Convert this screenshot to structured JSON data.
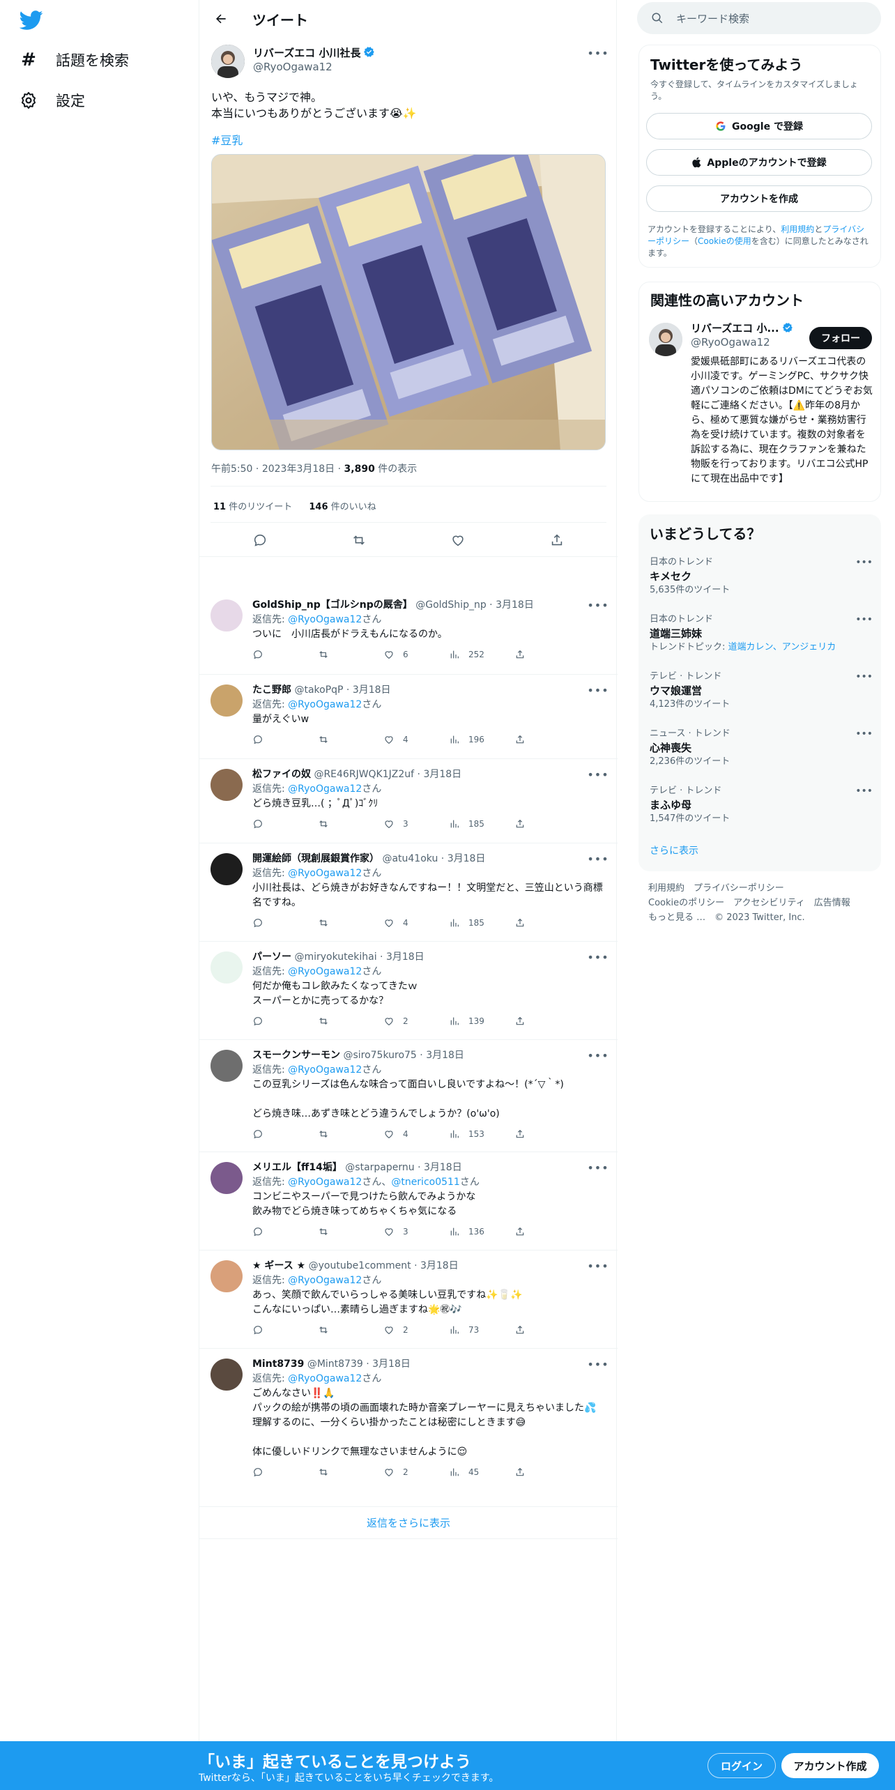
{
  "nav": {
    "explore_label": "話題を検索",
    "settings_label": "設定"
  },
  "header": {
    "title": "ツイート"
  },
  "tweet": {
    "author_name": "リバーズエコ 小川社長",
    "author_handle": "@RyoOgawa12",
    "text": "いや、もうマジで神。\n本当にいつもありがとうございます😭✨",
    "hashtag": "#豆乳",
    "time": "午前5:50",
    "date": "2023年3月18日",
    "views_count": "3,890",
    "views_label": "件の表示",
    "retweets_count": "11",
    "retweets_label": "件のリツイート",
    "likes_count": "146",
    "likes_label": "件のいいね"
  },
  "reply_prefix": "返信先: ",
  "reply_suffix": "さん",
  "replies": [
    {
      "name": "GoldShip_np【ゴルシnpの厩舎】",
      "handle": "@GoldShip_np",
      "date": "3月18日",
      "to": "@RyoOgawa12",
      "to2": "",
      "text": "ついに　小川店長がドラえもんになるのか。",
      "likes": "6",
      "views": "252"
    },
    {
      "name": "たこ野郎",
      "handle": "@takoPqP",
      "date": "3月18日",
      "to": "@RyoOgawa12",
      "to2": "",
      "text": "量がえぐいw",
      "likes": "4",
      "views": "196"
    },
    {
      "name": "松ファイの奴",
      "handle": "@RE46RJWQK1JZ2uf",
      "date": "3月18日",
      "to": "@RyoOgawa12",
      "to2": "",
      "text": "どら焼き豆乳…( ；ﾟДﾟ)ｺﾞｸﾘ",
      "likes": "3",
      "views": "185"
    },
    {
      "name": "開運絵師（現創展銀賞作家）",
      "handle": "@atu41oku",
      "date": "3月18日",
      "to": "@RyoOgawa12",
      "to2": "",
      "text": "小川社長は、どら焼きがお好きなんですねー！！文明堂だと、三笠山という商標名ですね。",
      "likes": "4",
      "views": "185"
    },
    {
      "name": "パーソー",
      "handle": "@miryokutekihai",
      "date": "3月18日",
      "to": "@RyoOgawa12",
      "to2": "",
      "text": "何だか俺もコレ飲みたくなってきたｗ\nスーパーとかに売ってるかな？",
      "likes": "2",
      "views": "139"
    },
    {
      "name": "スモークンサーモン",
      "handle": "@siro75kuro75",
      "date": "3月18日",
      "to": "@RyoOgawa12",
      "to2": "",
      "text": "この豆乳シリーズは色んな味合って面白いし良いですよね～！(*´▽｀*)\n\nどら焼き味…あずき味とどう違うんでしょうか？(o'ω'o)",
      "likes": "4",
      "views": "153"
    },
    {
      "name": "メリエル【ff14垢】",
      "handle": "@starpapernu",
      "date": "3月18日",
      "to": "@RyoOgawa12",
      "to2": "@tnerico0511",
      "text": "コンビニやスーパーで見つけたら飲んでみようかな\n飲み物でどら焼き味ってめちゃくちゃ気になる",
      "likes": "3",
      "views": "136"
    },
    {
      "name": "★ ギース ★",
      "handle": "@youtube1comment",
      "date": "3月18日",
      "to": "@RyoOgawa12",
      "to2": "",
      "text": "あっ、笑顔で飲んでいらっしゃる美味しい豆乳ですね✨🥛✨\nこんなにいっぱい…素晴らし過ぎますね🌟㊗🎶",
      "likes": "2",
      "views": "73"
    },
    {
      "name": "Mint8739",
      "handle": "@Mint8739",
      "date": "3月18日",
      "to": "@RyoOgawa12",
      "to2": "",
      "text": "ごめんなさい‼️🙏\nパックの絵が携帯の頃の画面壊れた時か音楽プレーヤーに見えちゃいました💦\n理解するのに、一分くらい掛かったことは秘密にしときます😅\n\n体に優しいドリンクで無理なさいませんように😌",
      "likes": "2",
      "views": "45"
    }
  ],
  "show_more_replies": "返信をさらに表示",
  "sidebar": {
    "search_placeholder": "キーワード検索",
    "signup_title": "Twitterを使ってみよう",
    "signup_sub": "今すぐ登録して、タイムラインをカスタマイズしましょう。",
    "google_label": "Google で登録",
    "apple_label": "Appleのアカウントで登録",
    "create_label": "アカウントを作成",
    "terms_pre": "アカウントを登録することにより、",
    "terms_link": "利用規約",
    "terms_mid": "と",
    "privacy_link": "プライバシーポリシー",
    "terms_mid2": "（",
    "cookie_link": "Cookieの使用",
    "terms_post": "を含む）に同意したとみなされます。",
    "related_title": "関連性の高いアカウント",
    "related_name": "リバーズエコ 小...",
    "related_handle": "@RyoOgawa12",
    "follow_label": "フォロー",
    "related_bio": "愛媛県砥部町にあるリバーズエコ代表の小川凌です。ゲーミングPC、サクサク快適パソコンのご依頼はDMにてどうぞお気軽にご連絡ください。【⚠️昨年の8月から、極めて悪質な嫌がらせ・業務妨害行為を受け続けています。複数の対象者を訴訟する為に、現在クラファンを兼ねた物販を行っております。リバエコ公式HPにて現在出品中です】",
    "trends_title": "いまどうしてる？",
    "trends": [
      {
        "context": "日本のトレンド",
        "name": "キメセク",
        "sub": "5,635件のツイート",
        "topic": ""
      },
      {
        "context": "日本のトレンド",
        "name": "道端三姉妹",
        "sub": "トレンドトピック: ",
        "topic": "道端カレン、アンジェリカ"
      },
      {
        "context": "テレビ · トレンド",
        "name": "ウマ娘運営",
        "sub": "4,123件のツイート",
        "topic": ""
      },
      {
        "context": "ニュース · トレンド",
        "name": "心神喪失",
        "sub": "2,236件のツイート",
        "topic": ""
      },
      {
        "context": "テレビ · トレンド",
        "name": "まふゆ母",
        "sub": "1,547件のツイート",
        "topic": ""
      }
    ],
    "trends_more": "さらに表示",
    "footer": [
      "利用規約",
      "プライバシーポリシー",
      "Cookieのポリシー",
      "アクセシビリティ",
      "広告情報",
      "もっと見る …",
      "© 2023 Twitter, Inc."
    ]
  },
  "bottom": {
    "title": "「いま」起きていることを見つけよう",
    "sub": "Twitterなら、「いま」起きていることをいち早くチェックできます。",
    "login": "ログイン",
    "signup": "アカウント作成"
  },
  "colors": {
    "accent": "#1d9bf0",
    "text": "#0f1419",
    "muted": "#536471"
  }
}
